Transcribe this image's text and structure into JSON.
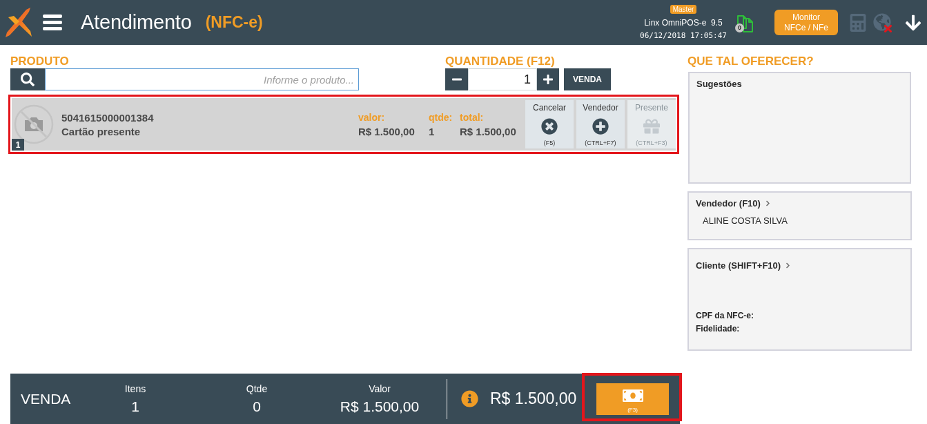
{
  "header": {
    "title": "Atendimento",
    "subtitle": "(NFC-e)",
    "badge": "Master",
    "app_version": "Linx OmniPOS-e  9.5",
    "datetime": "06/12/2018 17:05:47",
    "pending_documents": "0",
    "monitor_button": {
      "lines": [
        "Monitor",
        "NFCe / NFe"
      ]
    },
    "tools": [
      {
        "kind": "calculator",
        "disabled": true
      },
      {
        "kind": "globe",
        "online": false
      },
      {
        "kind": "download",
        "disabled": false
      }
    ]
  },
  "product": {
    "label": "PRODUTO",
    "placeholder": "Informe o produto..."
  },
  "quantity": {
    "label": "QUANTIDADE (F12)",
    "value": "1",
    "sell_button": "VENDA"
  },
  "items": [
    {
      "number": "1",
      "code": "5041615000001384",
      "name": "Cartão presente",
      "highlighted": true,
      "fields": [
        {
          "label": "valor:",
          "value": "R$ 1.500,00"
        },
        {
          "label": "qtde:",
          "value": "1"
        },
        {
          "label": "total:",
          "value": "R$ 1.500,00"
        }
      ],
      "actions": [
        {
          "kind": "cancel",
          "label": "Cancelar",
          "shortcut": "(F5)",
          "disabled": false
        },
        {
          "kind": "add",
          "label": "Vendedor",
          "shortcut": "(CTRL+F7)",
          "disabled": false
        },
        {
          "kind": "gift",
          "label": "Presente",
          "shortcut": "(CTRL+F3)",
          "disabled": true
        }
      ]
    }
  ],
  "offer": {
    "heading": "QUE TAL OFERECER?",
    "suggestions_title": "Sugestões",
    "seller": {
      "title": "Vendedor (F10)",
      "name": "ALINE COSTA SILVA"
    },
    "client": {
      "title": "Cliente (SHIFT+F10)",
      "fields": [
        "CPF da NFC-e:",
        "Fidelidade:"
      ]
    }
  },
  "summary": {
    "title": "VENDA",
    "stats": [
      {
        "label": "Itens",
        "value": "1"
      },
      {
        "label": "Qtde",
        "value": "0"
      },
      {
        "label": "Valor",
        "value": "R$ 1.500,00"
      }
    ],
    "total": "R$ 1.500,00",
    "pay_button": {
      "shortcut": "(F3)",
      "highlighted": true
    }
  }
}
